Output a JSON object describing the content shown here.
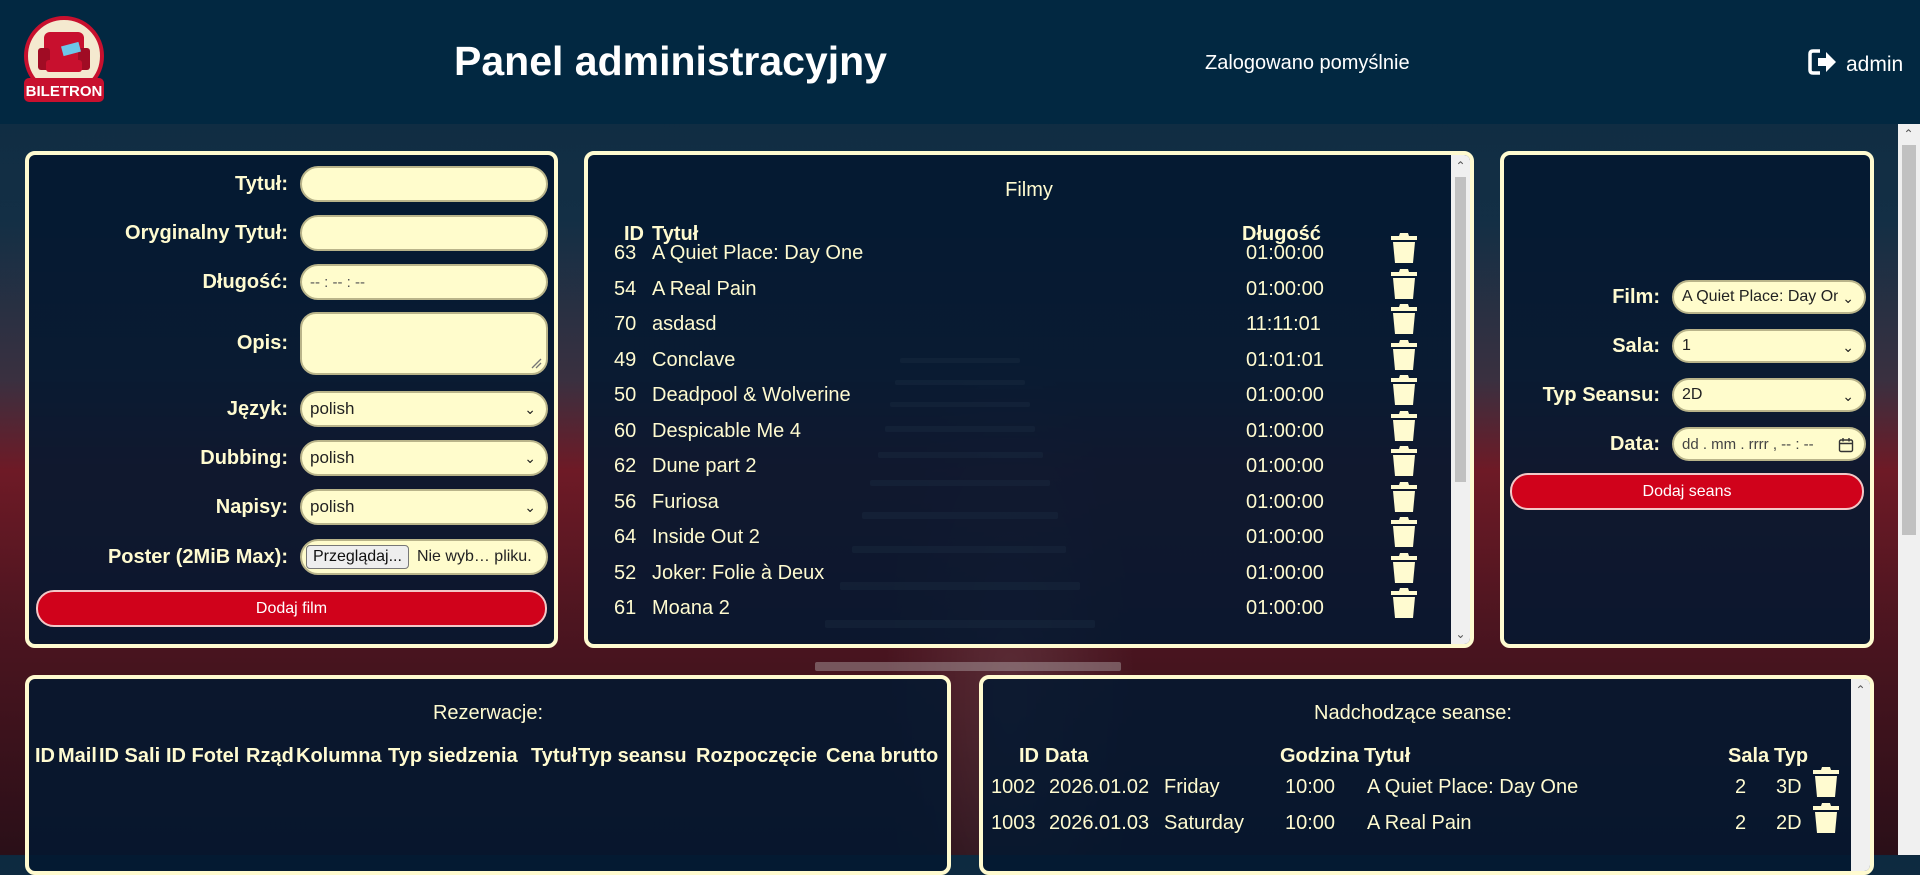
{
  "header": {
    "logo_text": "BILETRON",
    "title": "Panel administracyjny",
    "status": "Zalogowano pomyślnie",
    "user": "admin",
    "user_icon": "sign-out-icon"
  },
  "film_form": {
    "title_label": "Tytuł:",
    "title_value": "",
    "original_title_label": "Oryginalny Tytuł:",
    "original_title_value": "",
    "length_label": "Długość:",
    "length_placeholder": "-- : -- : --",
    "description_label": "Opis:",
    "description_value": "",
    "language_label": "Język:",
    "language_value": "polish",
    "dubbing_label": "Dubbing:",
    "dubbing_value": "polish",
    "subtitles_label": "Napisy:",
    "subtitles_value": "polish",
    "poster_label": "Poster (2MiB Max):",
    "poster_button": "Przeglądaj...",
    "poster_status": "Nie wyb… pliku.",
    "submit": "Dodaj film"
  },
  "films": {
    "title": "Filmy",
    "headers": {
      "id": "ID",
      "title": "Tytuł",
      "length": "Długość"
    },
    "rows": [
      {
        "id": "63",
        "title": "A Quiet Place: Day One",
        "length": "01:00:00"
      },
      {
        "id": "54",
        "title": "A Real Pain",
        "length": "01:00:00"
      },
      {
        "id": "70",
        "title": "asdasd",
        "length": "11:11:01"
      },
      {
        "id": "49",
        "title": "Conclave",
        "length": "01:01:01"
      },
      {
        "id": "50",
        "title": "Deadpool & Wolverine",
        "length": "01:00:00"
      },
      {
        "id": "60",
        "title": "Despicable Me 4",
        "length": "01:00:00"
      },
      {
        "id": "62",
        "title": "Dune part 2",
        "length": "01:00:00"
      },
      {
        "id": "56",
        "title": "Furiosa",
        "length": "01:00:00"
      },
      {
        "id": "64",
        "title": "Inside Out 2",
        "length": "01:00:00"
      },
      {
        "id": "52",
        "title": "Joker: Folie à Deux",
        "length": "01:00:00"
      },
      {
        "id": "61",
        "title": "Moana 2",
        "length": "01:00:00"
      }
    ]
  },
  "seance_form": {
    "film_label": "Film:",
    "film_value": "A Quiet Place: Day One",
    "hall_label": "Sala:",
    "hall_value": "1",
    "type_label": "Typ Seansu:",
    "type_value": "2D",
    "date_label": "Data:",
    "date_placeholder": "dd . mm . rrrr ,  -- : --",
    "submit": "Dodaj seans"
  },
  "reservations": {
    "title": "Rezerwacje:",
    "headers": [
      "ID",
      "Mail",
      "ID Sali",
      "ID Fotel",
      "Rząd",
      "Kolumna",
      "Typ siedzenia",
      "Tytuł",
      "Typ seansu",
      "Rozpoczęcie",
      "Cena brutto"
    ]
  },
  "upcoming": {
    "title": "Nadchodzące seanse:",
    "headers": {
      "id": "ID",
      "date": "Data",
      "hour": "Godzina",
      "title": "Tytuł",
      "hall": "Sala",
      "type": "Typ"
    },
    "rows": [
      {
        "id": "1002",
        "date": "2026.01.02",
        "day": "Friday",
        "hour": "10:00",
        "title": "A Quiet Place: Day One",
        "hall": "2",
        "type": "3D"
      },
      {
        "id": "1003",
        "date": "2026.01.03",
        "day": "Saturday",
        "hour": "10:00",
        "title": "A Real Pain",
        "hall": "2",
        "type": "2D"
      }
    ]
  },
  "colors": {
    "accent": "#d0021b",
    "cream": "#fffbd0",
    "topbar": "#022841",
    "field": "#fffccc"
  }
}
